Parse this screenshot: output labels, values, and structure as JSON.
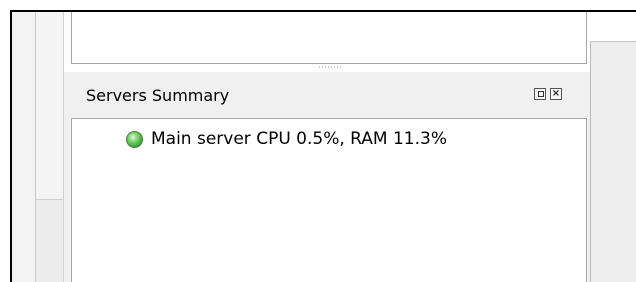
{
  "dock": {
    "title": "Servers Summary",
    "float_button": "float",
    "close_button": "close"
  },
  "servers": [
    {
      "label": "Main server CPU 0.5%, RAM 11.3%",
      "status": "online",
      "status_color": "#3c9c34"
    }
  ],
  "icons": {
    "status": "green-status-light-icon",
    "float": "restore-window-icon",
    "close": "close-x-icon"
  }
}
